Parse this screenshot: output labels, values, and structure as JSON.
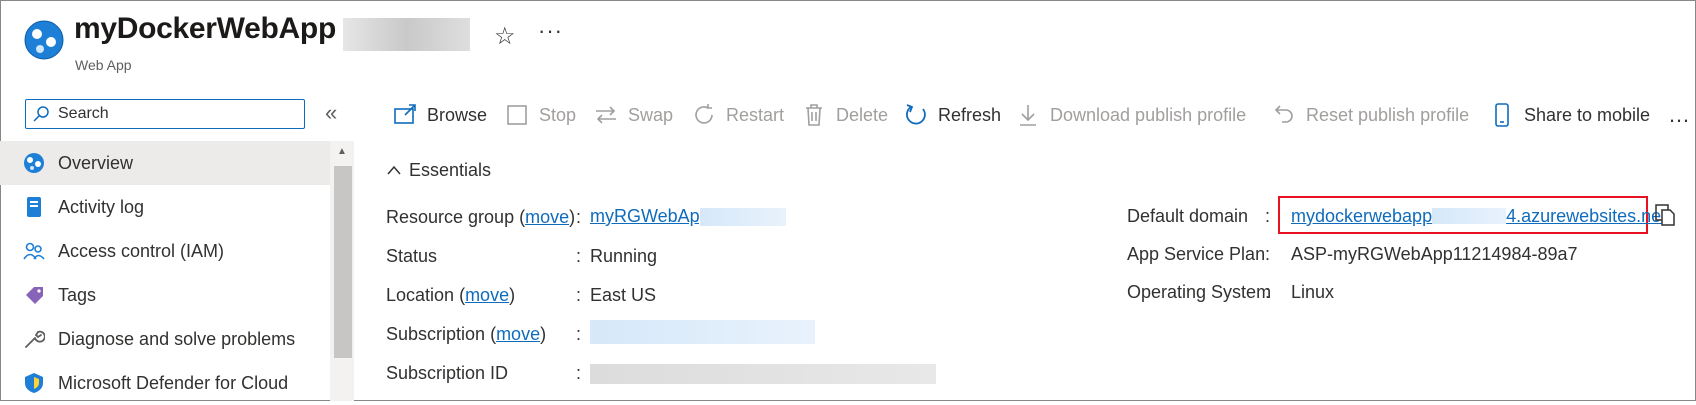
{
  "header": {
    "title": "myDockerWebApp",
    "subtitle": "Web App",
    "star_icon": "star-icon",
    "more_icon": "more-icon"
  },
  "sidebar": {
    "search": {
      "label": "Search"
    },
    "items": [
      {
        "label": "Overview",
        "icon": "overview-globe-icon",
        "active": true
      },
      {
        "label": "Activity log",
        "icon": "activity-log-icon"
      },
      {
        "label": "Access control (IAM)",
        "icon": "people-icon"
      },
      {
        "label": "Tags",
        "icon": "tag-icon"
      },
      {
        "label": "Diagnose and solve problems",
        "icon": "wrench-icon"
      },
      {
        "label": "Microsoft Defender for Cloud",
        "icon": "shield-icon"
      }
    ]
  },
  "toolbar": {
    "browse": "Browse",
    "stop": "Stop",
    "swap": "Swap",
    "restart": "Restart",
    "delete": "Delete",
    "refresh": "Refresh",
    "download": "Download publish profile",
    "reset": "Reset publish profile",
    "share": "Share to mobile",
    "more": "…"
  },
  "essentials": {
    "heading": "Essentials",
    "resource_group_label": "Resource group",
    "move": "move",
    "resource_group_value": "myRGWebApp1-1",
    "status_label": "Status",
    "status_value": "Running",
    "location_label": "Location",
    "location_value": "East US",
    "subscription_label": "Subscription",
    "subscription_id_label": "Subscription ID",
    "default_domain_label": "Default domain",
    "default_domain_prefix": "mydockerwebapp",
    "default_domain_suffix": "4.azurewebsites.net",
    "app_service_plan_label": "App Service Plan",
    "app_service_plan_value": "ASP-myRGWebApp11214984-89a7",
    "os_label": "Operating System",
    "os_value": "Linux"
  },
  "colors": {
    "accent": "#0f6cbd",
    "highlight": "#e81123",
    "nav_active": "#edebe9"
  }
}
